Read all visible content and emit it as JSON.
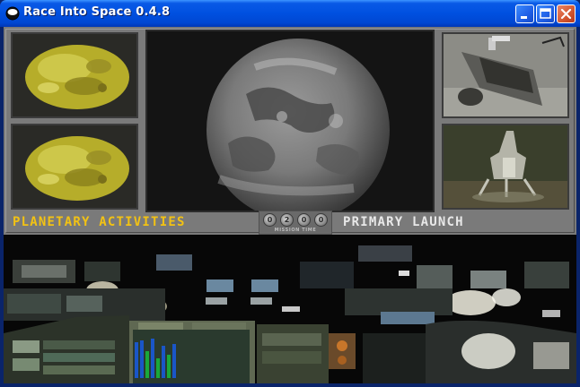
{
  "window": {
    "title": "Race Into Space 0.4.8",
    "buttons": [
      "minimize",
      "maximize",
      "close"
    ]
  },
  "screen": {
    "left_label": "PLANETARY ACTIVITIES",
    "right_label": "PRIMARY LAUNCH",
    "mission_time": {
      "label": "MISSION TIME",
      "digits": [
        "0",
        "2",
        "0",
        "0"
      ]
    }
  },
  "colors": {
    "left_label": "#f2c214",
    "right_label": "#e8e8e8",
    "titlebar": "#0050e0",
    "close_button": "#d65a32"
  },
  "icons": {
    "app": "globe-icon",
    "minimize": "minimize-icon",
    "maximize": "maximize-icon",
    "close": "close-icon"
  }
}
